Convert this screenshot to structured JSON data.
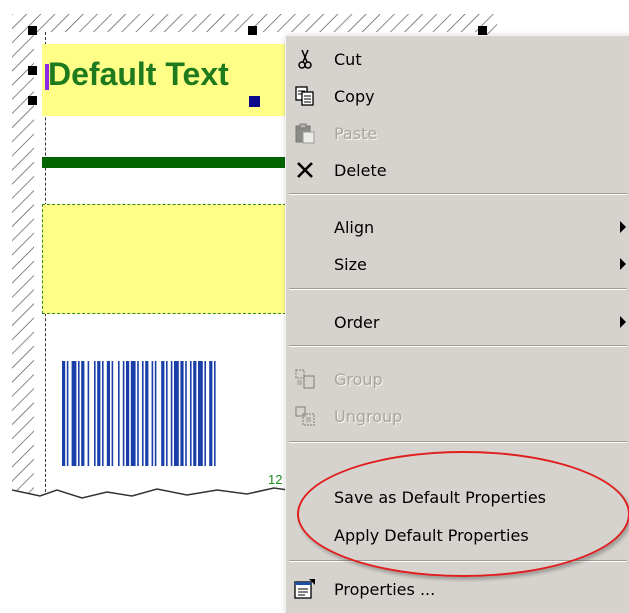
{
  "canvas": {
    "text_object": "Default Text",
    "barcode_number_partial": "12"
  },
  "context_menu": {
    "items": [
      {
        "label": "Cut",
        "icon": "scissors-icon",
        "enabled": true
      },
      {
        "label": "Copy",
        "icon": "copy-icon",
        "enabled": true
      },
      {
        "label": "Paste",
        "icon": "clipboard-icon",
        "enabled": false
      },
      {
        "label": "Delete",
        "icon": "delete-x-icon",
        "enabled": true
      },
      {
        "label": "Align",
        "submenu": true,
        "enabled": true
      },
      {
        "label": "Size",
        "submenu": true,
        "enabled": true
      },
      {
        "label": "Order",
        "submenu": true,
        "enabled": true
      },
      {
        "label": "Group",
        "icon": "group-icon",
        "enabled": false
      },
      {
        "label": "Ungroup",
        "icon": "ungroup-icon",
        "enabled": false
      },
      {
        "label": "Save as Default Properties",
        "enabled": true
      },
      {
        "label": "Apply Default Properties",
        "enabled": true
      },
      {
        "label": "Properties ...",
        "icon": "properties-icon",
        "enabled": true
      }
    ]
  },
  "colors": {
    "highlight_ellipse": "#e01e1e",
    "text_object_fill": "#ffff88",
    "text_color": "#1d7a1d",
    "barcode_color": "#1a3fa8"
  }
}
